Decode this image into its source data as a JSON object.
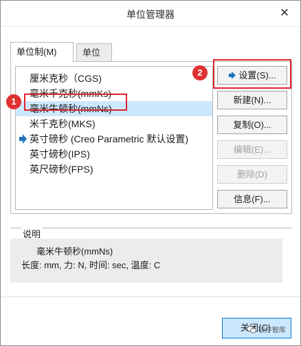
{
  "window": {
    "title": "单位管理器",
    "close_glyph": "✕"
  },
  "tabs": [
    {
      "label": "单位制(M)",
      "active": true
    },
    {
      "label": "单位",
      "active": false
    }
  ],
  "unit_systems": [
    {
      "label": "厘米克秒（CGS)",
      "selected": false,
      "default": false
    },
    {
      "label": "毫米千克秒(mmKs)",
      "selected": false,
      "default": false
    },
    {
      "label": "毫米牛顿秒(mmNs)",
      "selected": true,
      "default": false
    },
    {
      "label": "米千克秒(MKS)",
      "selected": false,
      "default": false
    },
    {
      "label": "英寸磅秒 (Creo Parametric 默认设置)",
      "selected": false,
      "default": true
    },
    {
      "label": "英寸磅秒(IPS)",
      "selected": false,
      "default": false
    },
    {
      "label": "英尺磅秒(FPS)",
      "selected": false,
      "default": false
    }
  ],
  "buttons": {
    "set": "设置(S)...",
    "new": "新建(N)...",
    "copy": "复制(O)...",
    "edit": "编辑(E)...",
    "delete": "删除(D)",
    "info": "信息(F)..."
  },
  "description": {
    "label": "说明",
    "name": "毫米牛顿秒(mmNs)",
    "details": "长度: mm, 力: N, 时间: sec, 温度: C"
  },
  "annotations": {
    "marker1": "1",
    "marker2": "2"
  },
  "footer": {
    "close": "关闭(C)",
    "watermark": "软件智库"
  },
  "colors": {
    "selection": "#cce8ff",
    "highlight": "#e0202a",
    "default_arrow": "#1e73be"
  },
  "icons": {
    "default_marker": "right-arrow-icon",
    "set_button_icon": "right-arrow-icon"
  }
}
